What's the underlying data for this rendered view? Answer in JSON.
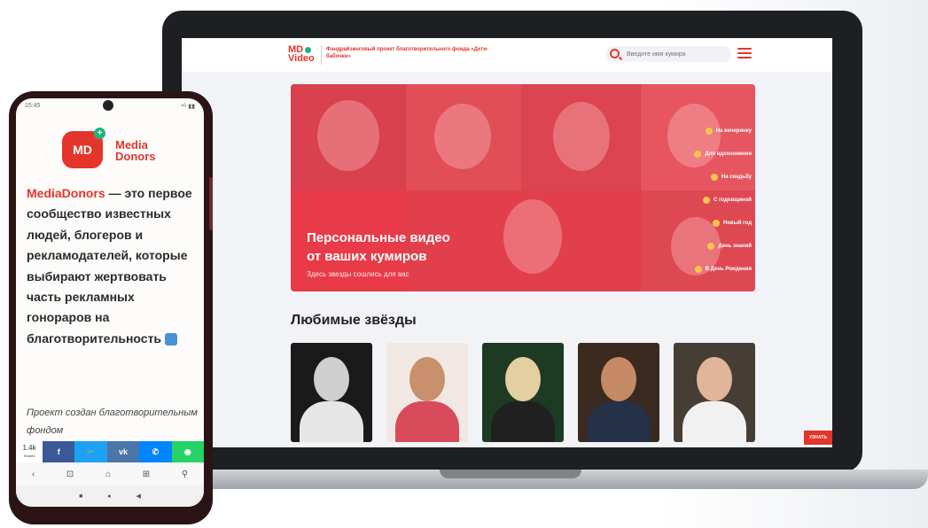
{
  "site": {
    "logo_line1": "MD",
    "logo_line2": "Video",
    "tagline": "Фандрайзинговый проект благотворительного фонда «Дети-бабочки»",
    "search_placeholder": "Введите имя кумира",
    "hero_title_line1": "Персональные видео",
    "hero_title_line2": "от ваших кумиров",
    "hero_subtitle": "Здесь звезды сошлись для вас",
    "occasions": [
      "На вечеринку",
      "Для вдохновения",
      "На свадьбу",
      "С годовщиной",
      "Новый год",
      "День знаний",
      "В День Рождения"
    ],
    "section_title": "Любимые звёзды",
    "corner_badge": "УЗНАТЬ"
  },
  "phone": {
    "status_time": "15:45",
    "status_right": "⁴ᴳ ▮▮",
    "logo_text": "MD",
    "logo_plus": "+",
    "brand_line1": "Media",
    "brand_line2": "Donors",
    "intro_brand": "MediaDonors",
    "intro_rest": " — это первое сообщество известных людей, блогеров и рекламодателей, которые выбирают жертвовать часть рекламных гонораров на благотворительность",
    "project_text": "Проект создан благотворительным фондом",
    "share_count": "1.4k",
    "share_label": "Shares",
    "share_buttons": [
      "f",
      "🐦",
      "vk",
      "✆",
      "◉"
    ],
    "browser_icons": [
      "‹",
      "⊡",
      "⌂",
      "⊞",
      "⚲"
    ],
    "nav_icons": [
      "■",
      "●",
      "◀"
    ]
  },
  "colors": {
    "brand_red": "#e4352b",
    "brand_green": "#1db57b",
    "facebook": "#3b5998",
    "twitter": "#1da1f2",
    "vk": "#4a76a8",
    "messenger": "#0084ff",
    "whatsapp": "#25d366"
  }
}
